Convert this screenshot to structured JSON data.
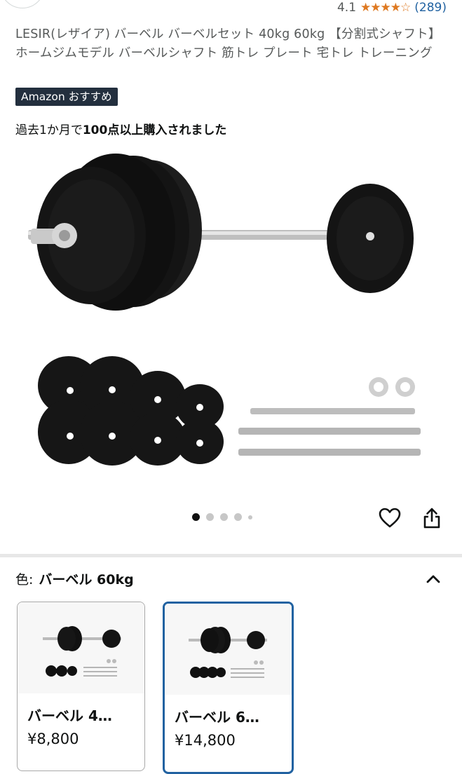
{
  "rating": {
    "score": "4.1",
    "stars_value": 4.1,
    "count": "(289)"
  },
  "product": {
    "title": "LESIR(レザイア) バーベル バーベルセット 40kg 60kg 【分割式シャフト】ホームジムモデル バーベルシャフト 筋トレ プレート 宅トレ トレーニング",
    "badge": "Amazon おすすめ",
    "bought_prefix": "過去1か月で",
    "bought_bold": "100点以上購入されました"
  },
  "gallery": {
    "total_dots": 5,
    "active_index": 0
  },
  "icons": {
    "heart": "heart-icon",
    "share": "share-icon",
    "collapse": "chevron-up-icon",
    "star": "star-icon"
  },
  "variation": {
    "label": "色:",
    "selected_value": "バーベル 60kg",
    "options": [
      {
        "name": "バーベル 4…",
        "price": "¥8,800",
        "selected": false
      },
      {
        "name": "バーベル 6…",
        "price": "¥14,800",
        "selected": true
      }
    ]
  },
  "colors": {
    "accent_blue": "#2162a1",
    "star_orange": "#de7921",
    "badge_navy": "#232f3e"
  }
}
